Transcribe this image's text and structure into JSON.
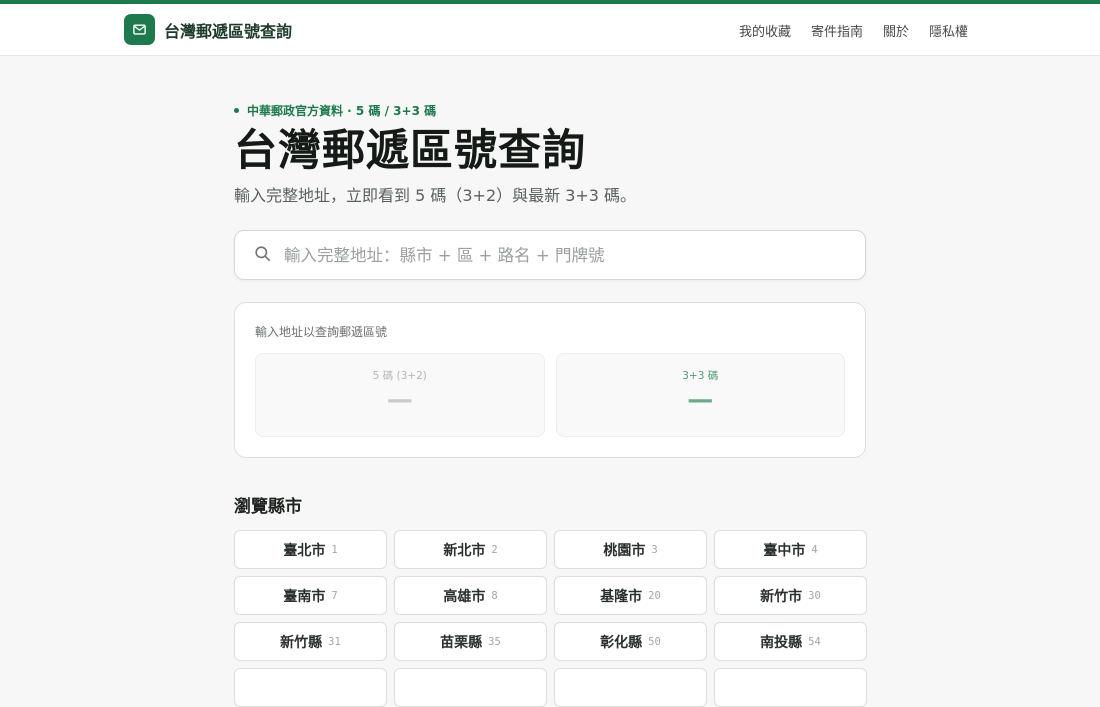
{
  "header": {
    "brand": "台灣郵遞區號查詢",
    "nav": [
      "我的收藏",
      "寄件指南",
      "關於",
      "隱私權"
    ]
  },
  "hero": {
    "eyebrow": "中華郵政官方資料 · 5 碼 / 3+3 碼",
    "title": "台灣郵遞區號查詢",
    "subtitle": "輸入完整地址，立即看到 5 碼（3+2）與最新 3+3 碼。"
  },
  "search": {
    "placeholder": "輸入完整地址：縣市 + 區 + 路名 + 門牌號",
    "value": ""
  },
  "result": {
    "hint": "輸入地址以查詢郵遞區號",
    "five_label": "5 碼 (3+2)",
    "five_value": "—",
    "six_label": "3+3 碼",
    "six_value": "—"
  },
  "browse": {
    "title": "瀏覽縣市",
    "cities": [
      {
        "name": "臺北市",
        "code": "1"
      },
      {
        "name": "新北市",
        "code": "2"
      },
      {
        "name": "桃園市",
        "code": "3"
      },
      {
        "name": "臺中市",
        "code": "4"
      },
      {
        "name": "臺南市",
        "code": "7"
      },
      {
        "name": "高雄市",
        "code": "8"
      },
      {
        "name": "基隆市",
        "code": "20"
      },
      {
        "name": "新竹市",
        "code": "30"
      },
      {
        "name": "新竹縣",
        "code": "31"
      },
      {
        "name": "苗栗縣",
        "code": "35"
      },
      {
        "name": "彰化縣",
        "code": "50"
      },
      {
        "name": "南投縣",
        "code": "54"
      },
      {
        "name": "",
        "code": ""
      },
      {
        "name": "",
        "code": ""
      },
      {
        "name": "",
        "code": ""
      },
      {
        "name": "",
        "code": ""
      }
    ]
  },
  "colors": {
    "accent": "#1e7a4d",
    "background": "#f6f7f6"
  },
  "icons": [
    "mail-icon",
    "search-icon"
  ]
}
